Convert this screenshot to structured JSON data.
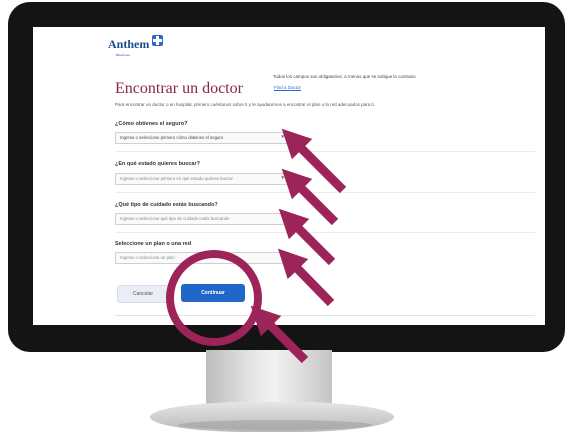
{
  "brand": {
    "name": "Anthem",
    "sub": "BlueCross"
  },
  "required_note": "Todos los campos son obligatorios, a menos que se indique lo contrario",
  "page_title": "Encontrar un doctor",
  "find_link": "Find a Doctor",
  "intro": "Para encontrar un doctor o un hospital, primero cuéntanos sobre ti y te ayudaremos a encontrar el plan o la red adecuados para ti.",
  "questions": [
    {
      "label": "¿Cómo obtienes el seguro?",
      "placeholder": "Ingrese o seleccione primero cómo obtienes el seguro"
    },
    {
      "label": "¿En qué estado quieres buscar?",
      "placeholder": "Ingrese o seleccione primero en qué estado quieres buscar"
    },
    {
      "label": "¿Qué tipo de cuidado estás buscando?",
      "placeholder": "Ingrese o seleccione qué tipo de cuidado estás buscando"
    },
    {
      "label": "Seleccione un plan o una red",
      "placeholder": "Ingrese o seleccione un plan"
    }
  ],
  "buttons": {
    "cancel": "Cancelar",
    "continue": "Continuar"
  },
  "colors": {
    "accent": "#9c2459",
    "brand_blue": "#1f68c8",
    "title": "#8a2547"
  }
}
